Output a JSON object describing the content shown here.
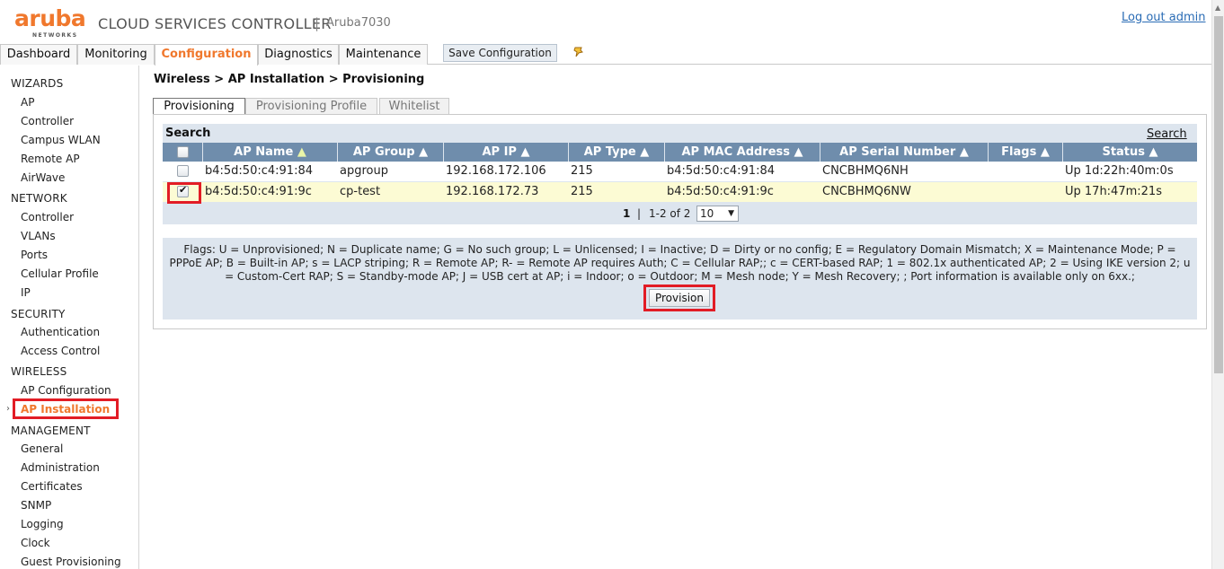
{
  "header": {
    "logo_word": "aruba",
    "logo_sub": "NETWORKS",
    "app_title": "CLOUD SERVICES CONTROLLER",
    "separator": "|",
    "device_name": "Aruba7030",
    "logout": "Log out admin"
  },
  "topnav": {
    "tabs": [
      "Dashboard",
      "Monitoring",
      "Configuration",
      "Diagnostics",
      "Maintenance"
    ],
    "active_tab": "Configuration",
    "save_button": "Save Configuration",
    "accent_color": "#f0782d"
  },
  "sidebar": {
    "sections": [
      {
        "title": "WIZARDS",
        "items": [
          "AP",
          "Controller",
          "Campus WLAN",
          "Remote AP",
          "AirWave"
        ]
      },
      {
        "title": "NETWORK",
        "items": [
          "Controller",
          "VLANs",
          "Ports",
          "Cellular Profile",
          "IP"
        ]
      },
      {
        "title": "SECURITY",
        "items": [
          "Authentication",
          "Access Control"
        ]
      },
      {
        "title": "WIRELESS",
        "items": [
          "AP Configuration",
          "AP Installation"
        ]
      },
      {
        "title": "MANAGEMENT",
        "items": [
          "General",
          "Administration",
          "Certificates",
          "SNMP",
          "Logging",
          "Clock",
          "Guest Provisioning"
        ]
      }
    ],
    "active_item": "AP Installation"
  },
  "main": {
    "breadcrumb": "Wireless > AP Installation > Provisioning",
    "subtabs": [
      "Provisioning",
      "Provisioning Profile",
      "Whitelist"
    ],
    "active_subtab": "Provisioning",
    "search_title": "Search",
    "search_link": "Search",
    "table": {
      "columns": [
        "AP Name",
        "AP Group",
        "AP IP",
        "AP Type",
        "AP MAC Address",
        "AP Serial Number",
        "Flags",
        "Status"
      ],
      "sort_marker_active": "▲",
      "sort_marker": "▲",
      "rows": [
        {
          "checked": false,
          "ap_name": "b4:5d:50:c4:91:84",
          "ap_group": "apgroup",
          "ap_ip": "192.168.172.106",
          "ap_type": "215",
          "ap_mac": "b4:5d:50:c4:91:84",
          "serial": "CNCBHMQ6NH",
          "flags": "",
          "status": "Up 1d:22h:40m:0s"
        },
        {
          "checked": true,
          "ap_name": "b4:5d:50:c4:91:9c",
          "ap_group": "cp-test",
          "ap_ip": "192.168.172.73",
          "ap_type": "215",
          "ap_mac": "b4:5d:50:c4:91:9c",
          "serial": "CNCBHMQ6NW",
          "flags": "",
          "status": "Up 17h:47m:21s"
        }
      ]
    },
    "pager": {
      "current_page": "1",
      "separator": "|",
      "range": "1-2 of 2",
      "page_size": "10"
    },
    "flags_legend": "Flags: U = Unprovisioned; N = Duplicate name; G = No such group; L = Unlicensed; I = Inactive; D = Dirty or no config; E = Regulatory Domain Mismatch; X = Maintenance Mode; P = PPPoE AP; B = Built-in AP; s = LACP striping; R = Remote AP; R- = Remote AP requires Auth; C = Cellular RAP;; c = CERT-based RAP; 1 = 802.1x authenticated AP; 2 = Using IKE version 2; u = Custom-Cert RAP; S = Standby-mode AP; J = USB cert at AP; i = Indoor; o = Outdoor; M = Mesh node; Y = Mesh Recovery; ; Port information is available only on 6xx.;",
    "provision_button": "Provision"
  }
}
